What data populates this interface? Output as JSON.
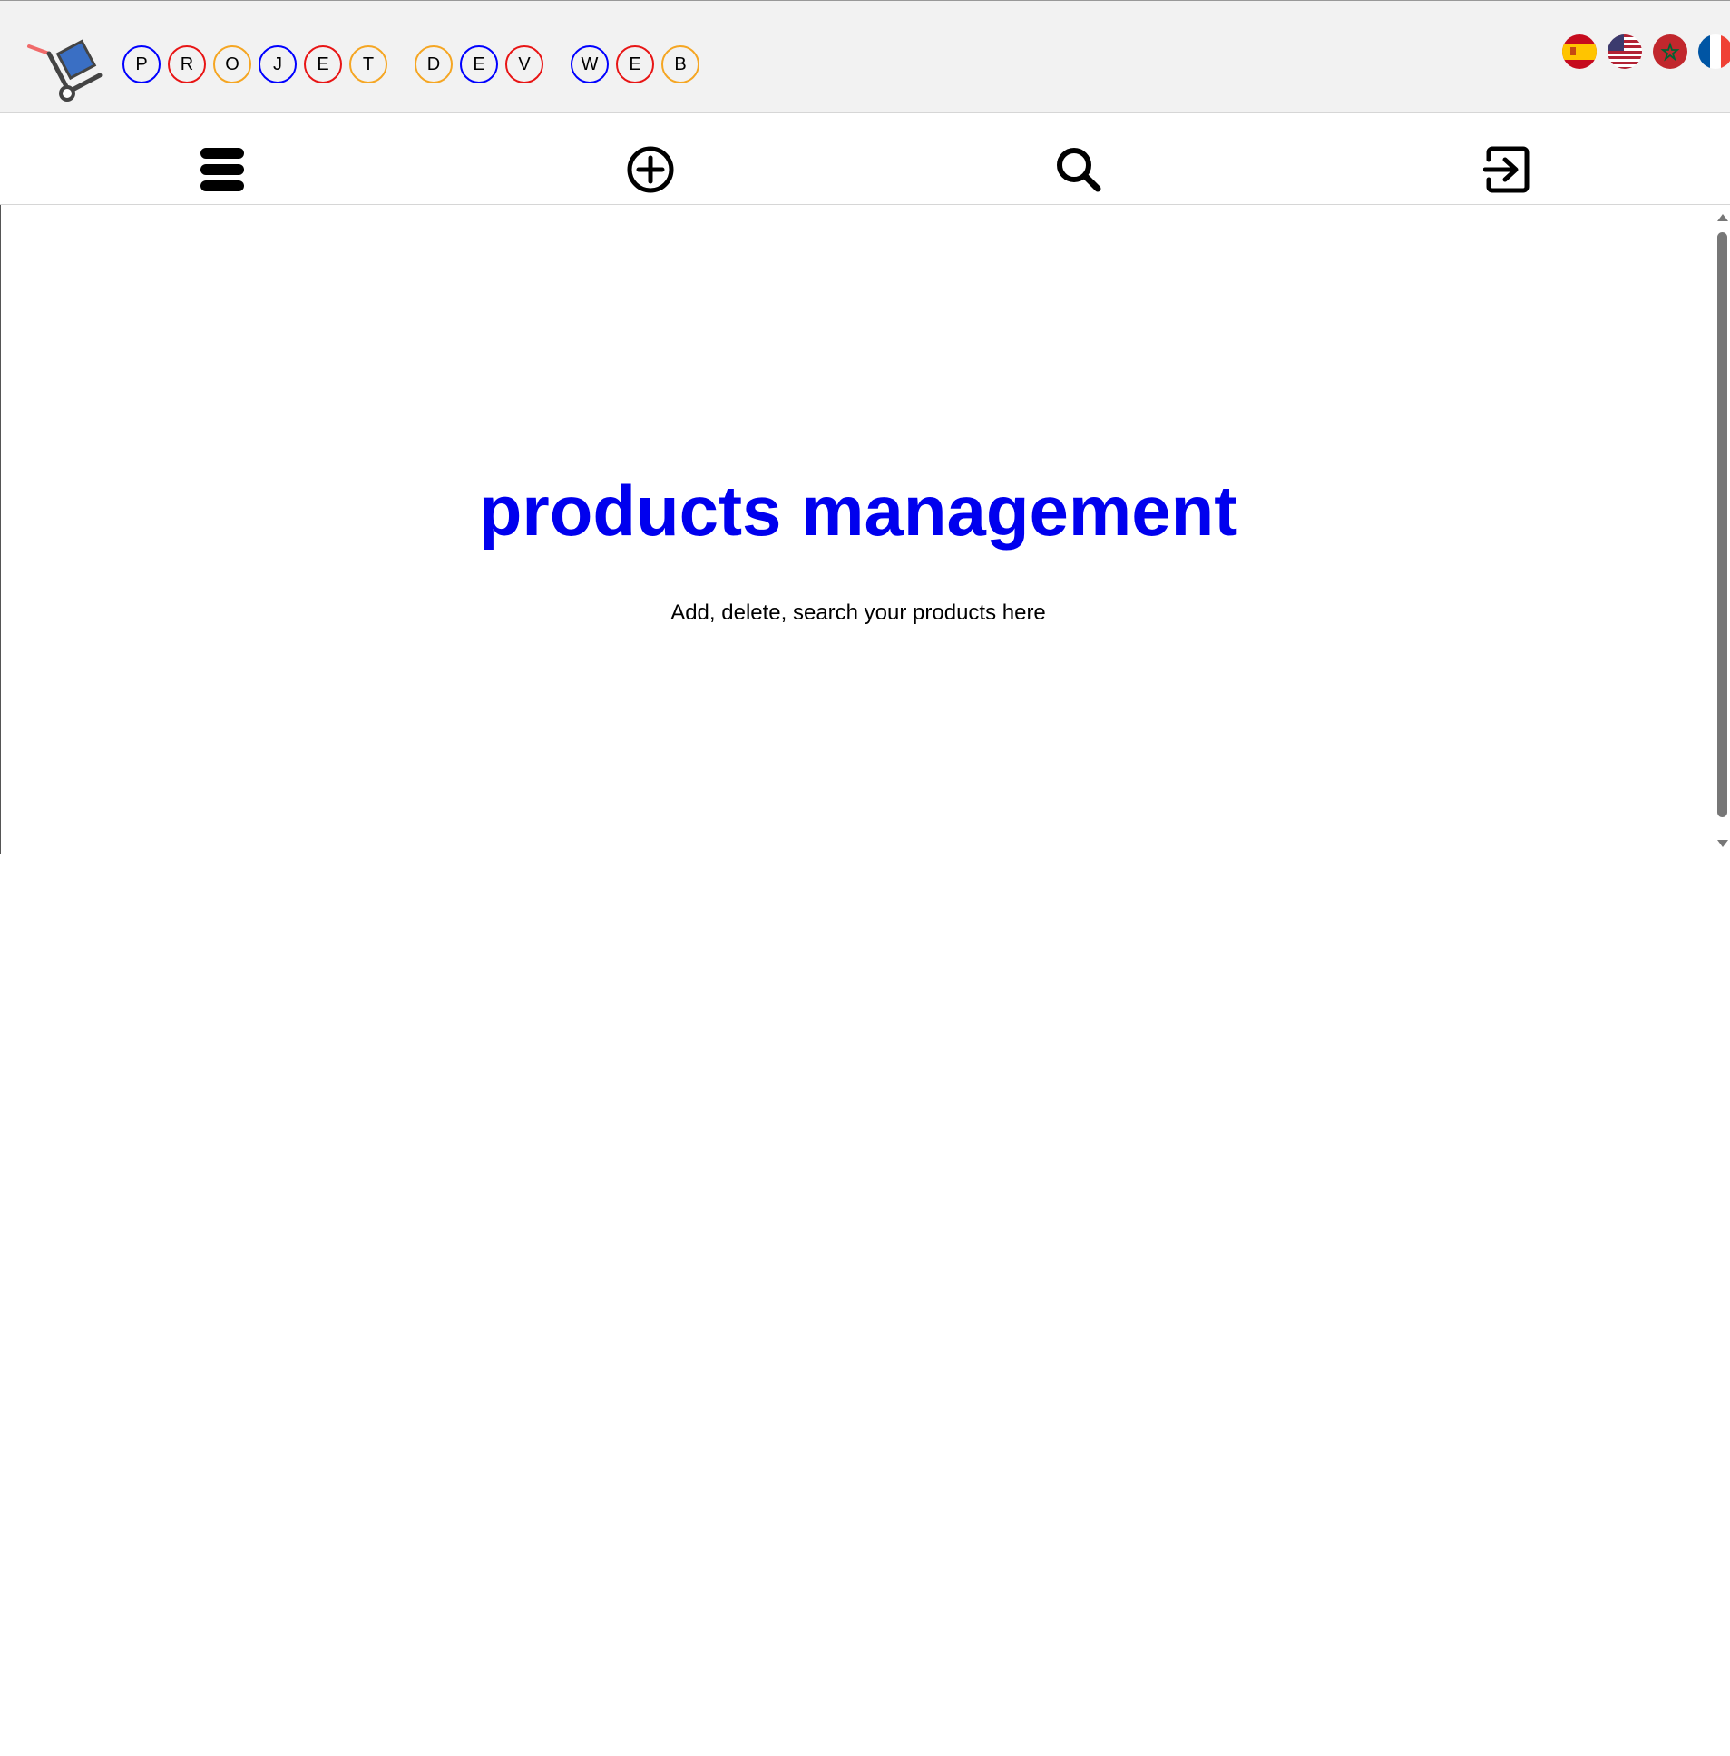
{
  "header": {
    "logo_icon": "hand-truck-icon",
    "title_letters": [
      {
        "char": "P",
        "color": "#0000ff"
      },
      {
        "char": "R",
        "color": "#e81515"
      },
      {
        "char": "O",
        "color": "#f5a623"
      },
      {
        "char": "J",
        "color": "#0000ff"
      },
      {
        "char": "E",
        "color": "#e81515"
      },
      {
        "char": "T",
        "color": "#f5a623"
      },
      {
        "char": "D",
        "color": "#f5a623"
      },
      {
        "char": "E",
        "color": "#0000ff"
      },
      {
        "char": "V",
        "color": "#e81515"
      },
      {
        "char": "W",
        "color": "#0000ff"
      },
      {
        "char": "E",
        "color": "#e81515"
      },
      {
        "char": "B",
        "color": "#f5a623"
      }
    ],
    "flags": [
      "spain-flag-icon",
      "usa-flag-icon",
      "morocco-flag-icon",
      "france-flag-icon"
    ]
  },
  "toolbar": {
    "icons": [
      "menu-icon",
      "add-circle-icon",
      "search-icon",
      "logout-icon"
    ]
  },
  "main": {
    "title": "products management",
    "subtitle": "Add, delete, search your products here",
    "title_color": "#0000ee"
  }
}
